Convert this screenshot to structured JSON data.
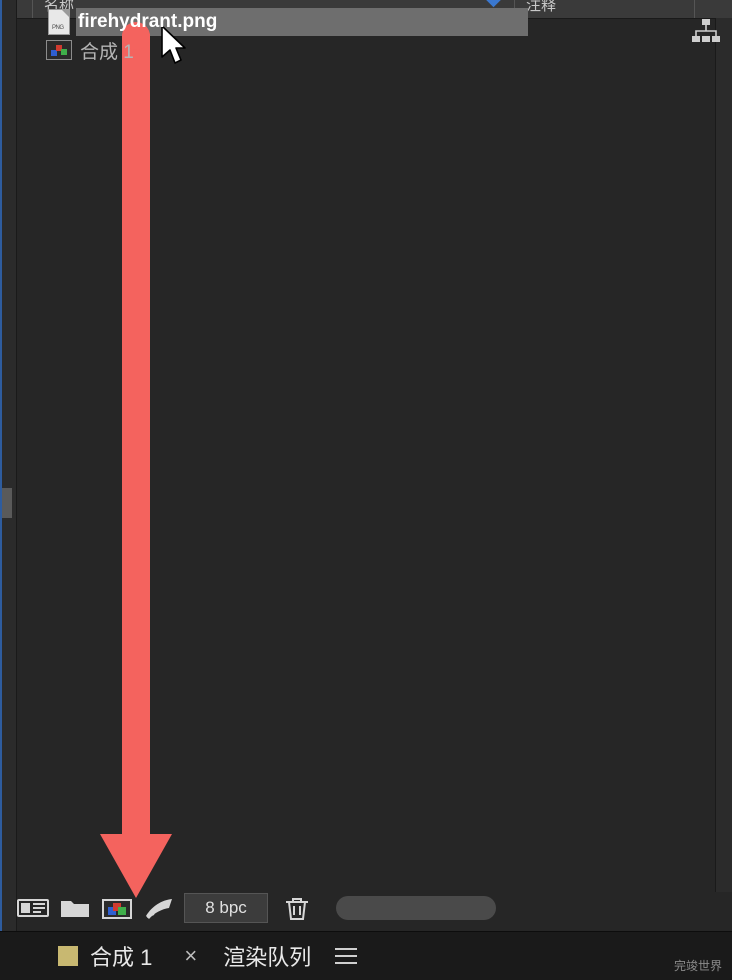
{
  "project_panel": {
    "columns": {
      "name_header": "名称",
      "comment_header": "注释"
    },
    "items": [
      {
        "label": "firehydrant.png",
        "icon": "png-file-icon",
        "icon_text": "PNG",
        "selected": true
      },
      {
        "label": "合成 1",
        "icon": "composition-icon",
        "selected": false
      }
    ],
    "flowchart_icon": "flowchart-icon",
    "toolbar": {
      "interpret_footage_icon": "interpret-footage-icon",
      "new_folder_icon": "new-folder-icon",
      "new_composition_icon": "new-composition-icon",
      "color_depth_icon": "project-settings-icon",
      "bit_depth_label": "8 bpc",
      "delete_icon": "trash-icon",
      "search_placeholder": ""
    }
  },
  "timeline_bar": {
    "comp_tab_label": "合成 1",
    "close_label": "×",
    "render_queue_label": "渲染队列",
    "menu_icon": "hamburger-menu-icon",
    "swatch_color": "#c8b871"
  },
  "watermark": "完竣世界",
  "annotation": {
    "arrow_color": "#f4635e",
    "arrow_name": "pointer-arrow-annotation"
  },
  "cursor": {
    "name": "mouse-cursor"
  }
}
